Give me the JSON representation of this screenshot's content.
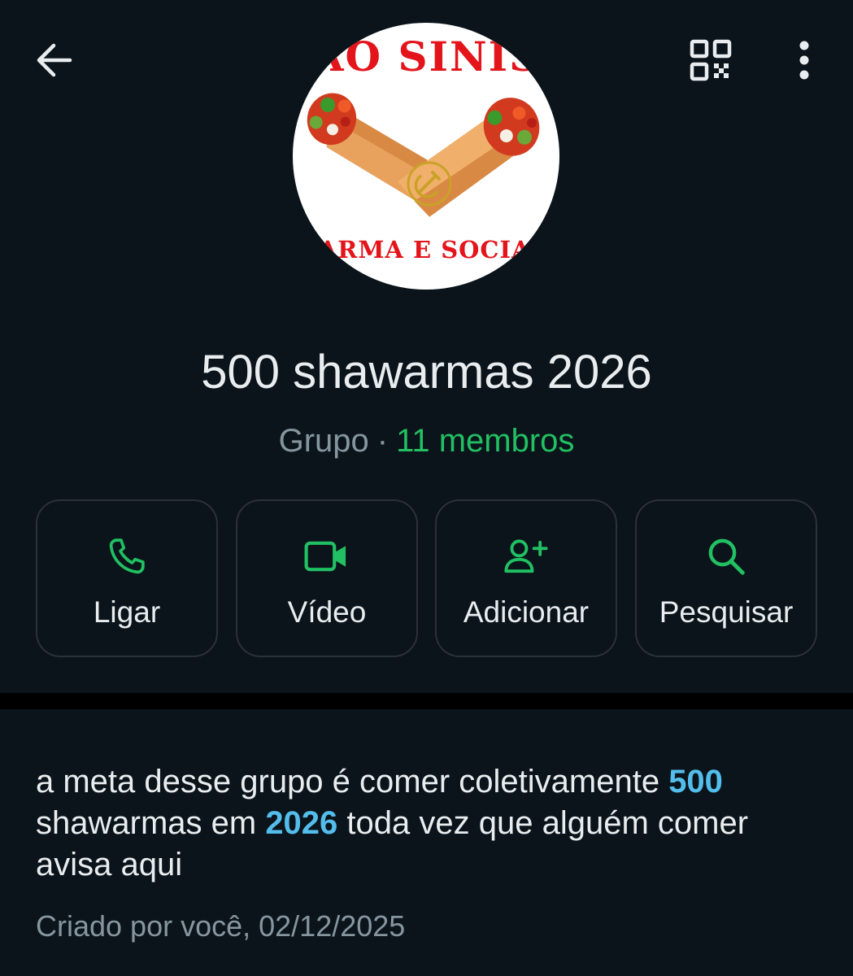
{
  "avatar": {
    "top_text": "AO SINIS",
    "bottom_text": "WARMA E SOCIALI"
  },
  "group": {
    "name": "500 shawarmas 2026",
    "type": "Grupo",
    "separator": "·",
    "members": "11 membros"
  },
  "actions": [
    {
      "label": "Ligar",
      "icon": "phone-icon"
    },
    {
      "label": "Vídeo",
      "icon": "video-camera-icon"
    },
    {
      "label": "Adicionar",
      "icon": "add-person-icon"
    },
    {
      "label": "Pesquisar",
      "icon": "search-icon"
    }
  ],
  "description": {
    "part1": "a meta desse grupo é comer coletivamente ",
    "highlight1": "500",
    "part2": " shawarmas em ",
    "highlight2": "2026",
    "part3": " toda vez que alguém comer avisa aqui"
  },
  "created": "Criado por você, 02/12/2025",
  "colors": {
    "background": "#0b141a",
    "accent_green": "#21c063",
    "link_blue": "#53bdeb",
    "secondary_text": "#8696a0",
    "primary_text": "#e9edef",
    "card_border": "#2a3238",
    "avatar_red": "#e4141b"
  }
}
